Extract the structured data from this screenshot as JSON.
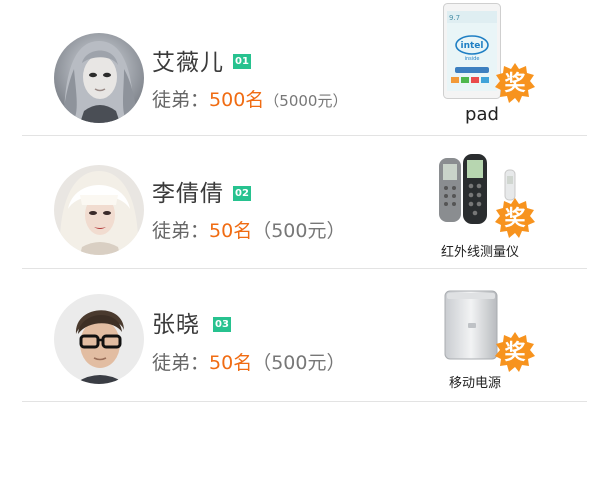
{
  "colors": {
    "rank_badge": "#27c28f",
    "count_text": "#f06c13",
    "prize_badge": "#f7931e",
    "divider": "#e3e3e3"
  },
  "winners": [
    {
      "name": "艾薇儿",
      "rank": "01",
      "label": "徒弟：",
      "count": "500名",
      "amount": "（5000元）",
      "prize_badge": "奖",
      "prize_name": "pad",
      "prize_icon": "tablet-icon"
    },
    {
      "name": "李倩倩",
      "rank": "02",
      "label": "徒弟：",
      "count": "50名",
      "amount": "（500元）",
      "prize_badge": "奖",
      "prize_name": "红外线测量仪",
      "prize_icon": "infrared-meter-icon"
    },
    {
      "name": "张晓",
      "rank": "03",
      "label": "徒弟：",
      "count": "50名",
      "amount": "（500元）",
      "prize_badge": "奖",
      "prize_name": "移动电源",
      "prize_icon": "power-bank-icon"
    }
  ],
  "tablet_screen": {
    "status_text": "9.7",
    "brand_text": "intel",
    "brand_sub": "inside"
  }
}
